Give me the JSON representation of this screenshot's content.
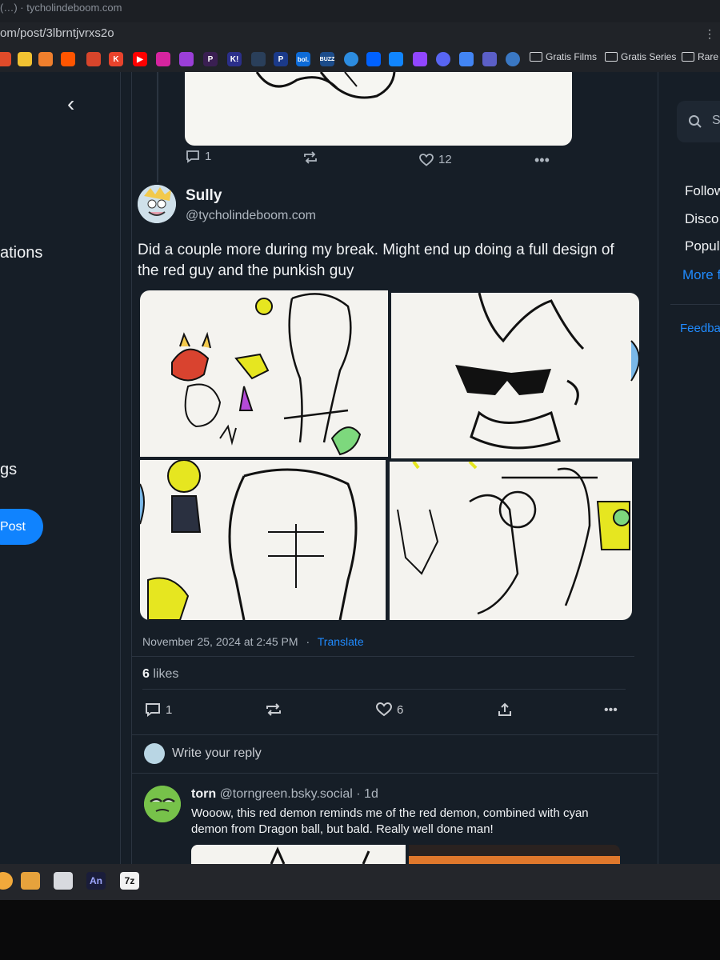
{
  "browser": {
    "tab_text": "(…) · tycholindeboom.com",
    "url": "om/post/3lbrntjvrxs2o",
    "bookmark_folders": [
      "Gratis Films",
      "Gratis Series",
      "Rare v"
    ],
    "bookmark_icons": [
      "k-icon",
      "p-icon",
      "k!-icon",
      "bol-icon",
      "buzz-icon"
    ],
    "bookmark_labels": {
      "k": "K",
      "p": "P",
      "k_excl": "K!",
      "bol": "bol.",
      "buzz": "BUZZ"
    }
  },
  "sidebar": {
    "back_icon": "‹",
    "notifications_partial": "ations",
    "settings_partial": "gs",
    "post_button": "Post"
  },
  "right": {
    "search_partial": "S",
    "links": [
      "Follow",
      "Disco",
      "Popul"
    ],
    "more": "More f",
    "feedback": "Feedba"
  },
  "prev_post": {
    "replies": "1",
    "likes": "12"
  },
  "post": {
    "display_name": "Sully",
    "handle": "@tycholindeboom.com",
    "text": "Did a couple more during my break. Might end up doing a full design of the red guy and the punkish guy",
    "timestamp": "November 25, 2024 at 2:45 PM",
    "separator": "·",
    "translate": "Translate",
    "likes_count": "6",
    "likes_label": "likes",
    "replies": "1",
    "like_count_action": "6"
  },
  "composer": {
    "placeholder": "Write your reply"
  },
  "reply": {
    "name": "torn",
    "handle": "@torngreen.bsky.social",
    "age": "· 1d",
    "text": "Wooow, this red demon reminds me of the red demon, combined with cyan demon from Dragon ball, but bald. Really well done man!"
  },
  "taskbar": {
    "an_label": "An",
    "z_label": "7z"
  },
  "colors": {
    "accent": "#208bfe",
    "post_button": "#1083fe",
    "background": "#161e27"
  }
}
